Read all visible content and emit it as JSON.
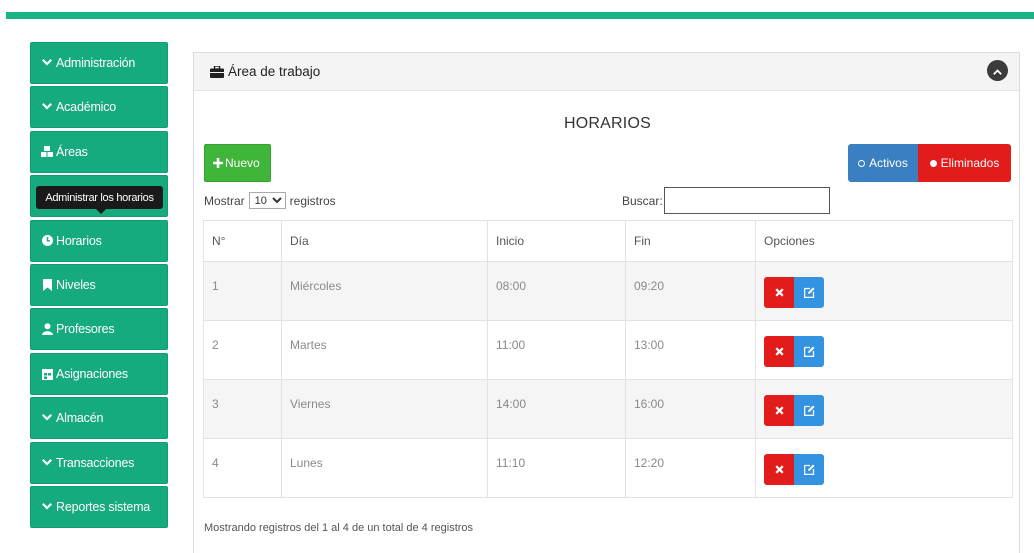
{
  "colors": {
    "accent": "#19b386",
    "sidebar": "#16ab7f",
    "nuevo": "#3fb639",
    "activos": "#3b7fc3",
    "eliminados": "#e21b1b",
    "edit": "#3393e0"
  },
  "sidebar": {
    "items": [
      {
        "label": "Administración",
        "icon": "chevron-down-icon"
      },
      {
        "label": "Académico",
        "icon": "chevron-down-icon"
      },
      {
        "label": "Áreas",
        "icon": "cubes-icon"
      },
      {
        "label": "",
        "icon": "",
        "tooltip": "Administrar los horarios"
      },
      {
        "label": "Horarios",
        "icon": "clock-icon"
      },
      {
        "label": "Niveles",
        "icon": "bookmark-icon"
      },
      {
        "label": "Profesores",
        "icon": "user-icon"
      },
      {
        "label": "Asignaciones",
        "icon": "calendar-icon"
      },
      {
        "label": "Almacén",
        "icon": "chevron-down-icon"
      },
      {
        "label": "Transacciones",
        "icon": "chevron-down-icon"
      },
      {
        "label": "Reportes sistema",
        "icon": "chevron-down-icon"
      }
    ]
  },
  "panel": {
    "title": "Área de trabajo",
    "heading": "HORARIOS",
    "new_label": "Nuevo",
    "filter": {
      "activos": "Activos",
      "eliminados": "Eliminados"
    },
    "length": {
      "prefix": "Mostrar",
      "value": "10",
      "suffix": "registros"
    },
    "search_label": "Buscar:",
    "search_value": "",
    "columns": [
      "N°",
      "Día",
      "Inicio",
      "Fin",
      "Opciones"
    ],
    "rows": [
      {
        "n": "1",
        "dia": "Miércoles",
        "inicio": "08:00",
        "fin": "09:20"
      },
      {
        "n": "2",
        "dia": "Martes",
        "inicio": "11:00",
        "fin": "13:00"
      },
      {
        "n": "3",
        "dia": "Viernes",
        "inicio": "14:00",
        "fin": "16:00"
      },
      {
        "n": "4",
        "dia": "Lunes",
        "inicio": "11:10",
        "fin": "12:20"
      }
    ],
    "info": "Mostrando registros del 1 al 4 de un total de 4 registros"
  }
}
